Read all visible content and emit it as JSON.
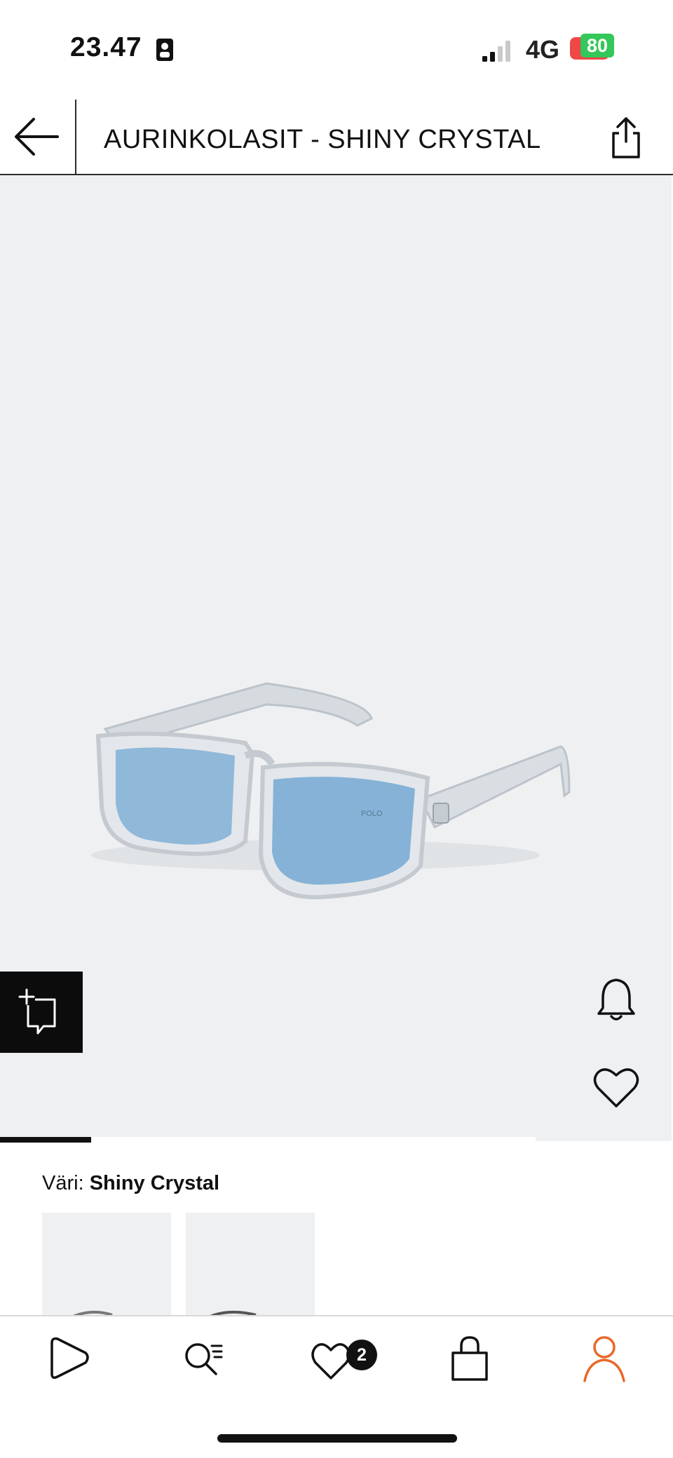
{
  "status_bar": {
    "time": "23.47",
    "network": "4G",
    "battery": "80"
  },
  "header": {
    "title": "AURINKOLASIT - SHINY CRYSTAL",
    "back_icon": "arrow-left-icon",
    "share_icon": "share-icon"
  },
  "product": {
    "brand_on_lens": "POLO",
    "image_progress": 0.17,
    "actions": [
      "try-on-icon",
      "bell-icon",
      "heart-icon"
    ]
  },
  "color_section": {
    "label": "Väri:",
    "value": "Shiny Crystal",
    "swatches": [
      "swatch-1",
      "swatch-2"
    ]
  },
  "bottom_nav": {
    "items": [
      "home-icon",
      "search-icon",
      "wishlist-icon",
      "bag-icon",
      "account-icon"
    ],
    "wishlist_count": "2",
    "active_color": "#e8682a"
  }
}
